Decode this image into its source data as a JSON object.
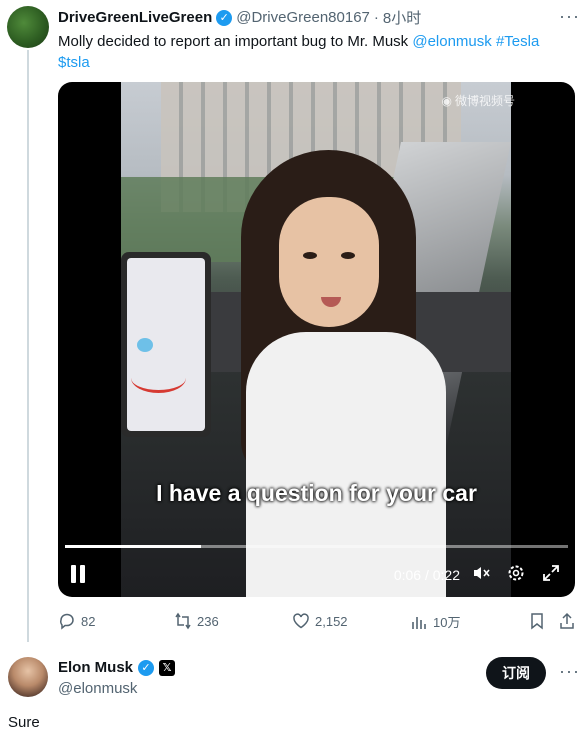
{
  "tweet": {
    "author_name": "DriveGreenLiveGreen",
    "verified_icon": "verified-badge-icon",
    "handle": "@DriveGreen80167",
    "separator": "·",
    "time": "8小时",
    "text_prefix": "Molly decided to report an important bug to Mr. Musk ",
    "mention": "@elonmusk",
    "hashtag": "#Tesla",
    "cashtag": "$tsla",
    "more": "···",
    "video": {
      "watermark": "微博视频号",
      "subtitle": "I have a question for your car",
      "current_time": "0:06",
      "duration": "0:22",
      "time_separator": " / ",
      "progress_fraction": 0.27
    },
    "actions": {
      "replies": "82",
      "retweets": "236",
      "likes": "2,152",
      "views": "10万"
    }
  },
  "reply": {
    "author_name": "Elon Musk",
    "handle": "@elonmusk",
    "x_badge": "𝕏",
    "follow_label": "订阅",
    "more": "···",
    "text": "Sure"
  },
  "colors": {
    "link": "#1d9bf0",
    "text": "#0f1419",
    "muted": "#536471"
  }
}
